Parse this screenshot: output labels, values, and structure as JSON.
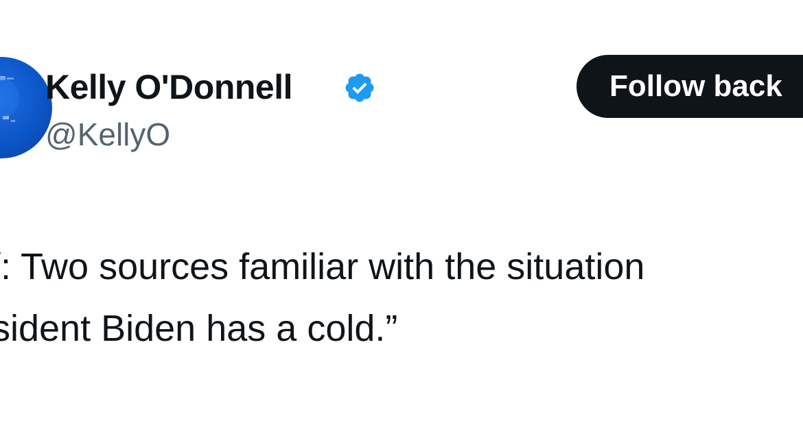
{
  "tweet": {
    "author": {
      "display_name": "Kelly O'Donnell",
      "handle": "@KellyO",
      "verified": true,
      "verified_icon": "verified-badge-icon",
      "avatar_color": "#0b56c8"
    },
    "follow_button_label": "Follow back",
    "text_lines": [
      "/: Two sources familiar with the situation",
      "sident Biden  has a cold.”"
    ]
  },
  "colors": {
    "text": "#0f1419",
    "secondary_text": "#536471",
    "verified_blue": "#1d9bf0",
    "button_bg": "#0f1419",
    "button_text": "#ffffff"
  }
}
